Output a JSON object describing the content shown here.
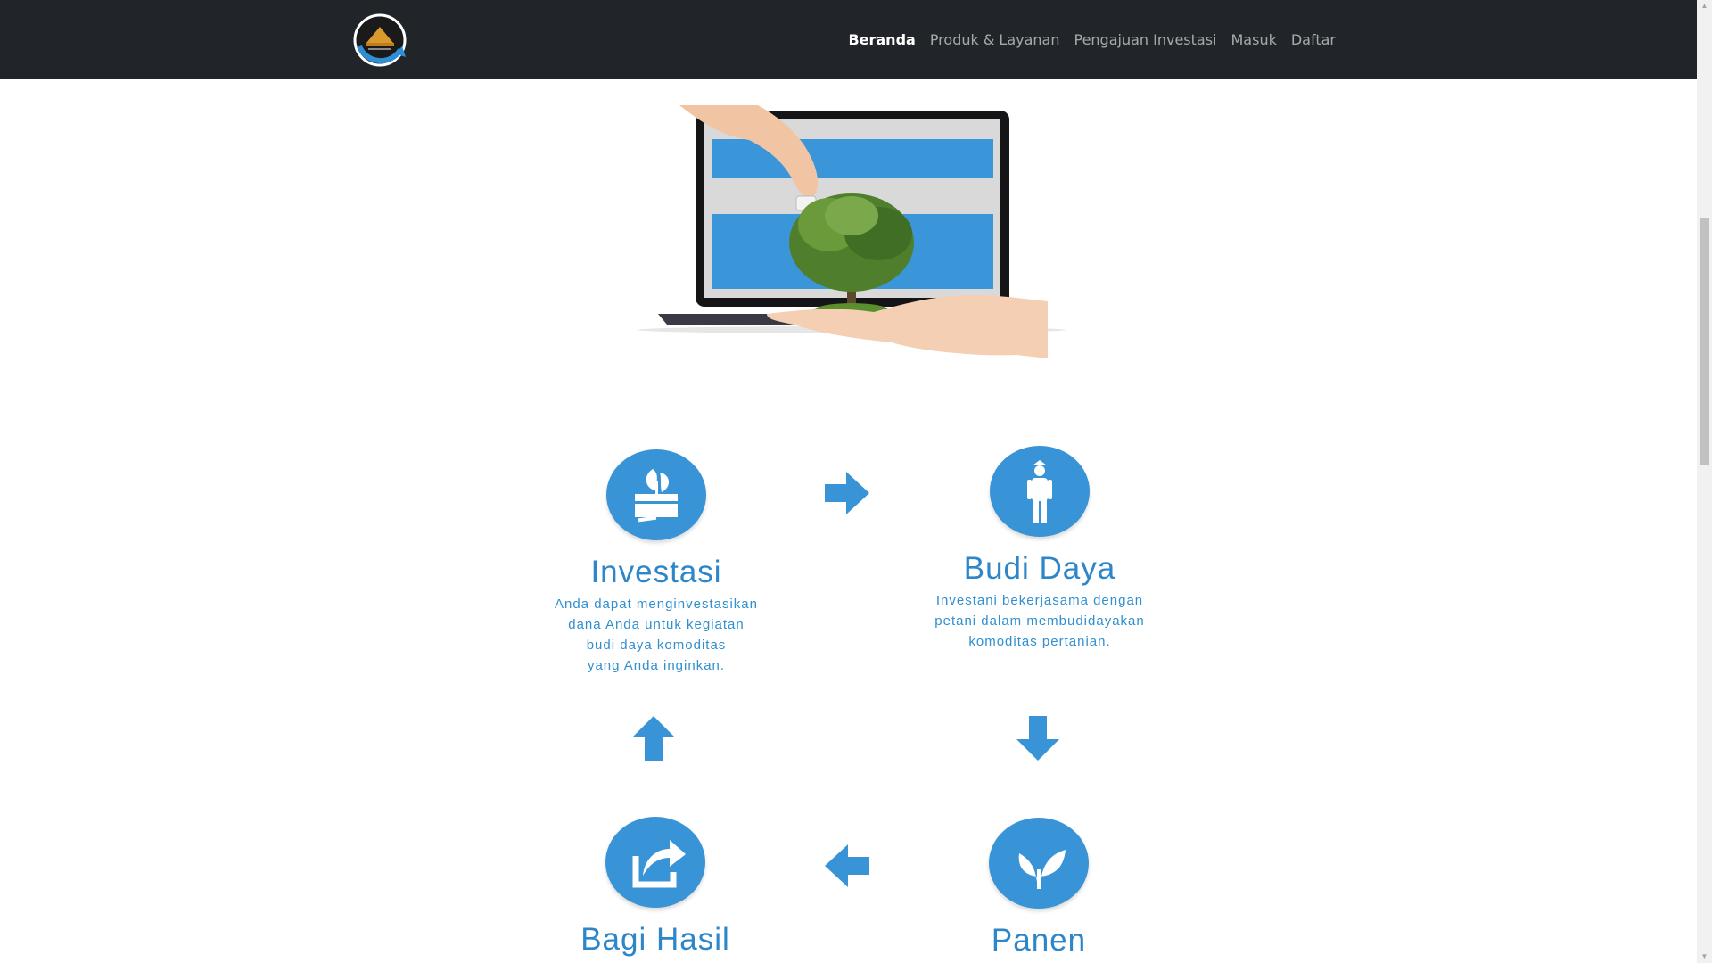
{
  "nav": {
    "logo_icon": "investani-logo",
    "links": [
      "Beranda",
      "Produk & Layanan",
      "Pengajuan Investasi",
      "Masuk",
      "Daftar"
    ],
    "active": "Beranda"
  },
  "hero": {
    "illustration": "laptop-hand-tree"
  },
  "steps": {
    "investasi": {
      "title": "Investasi",
      "desc": [
        "Anda dapat menginvestasikan",
        "dana Anda untuk kegiatan",
        "budi daya komoditas",
        "yang Anda inginkan."
      ],
      "icon": "invest-box-icon"
    },
    "budidaya": {
      "title": "Budi Daya",
      "desc": [
        "Investani bekerjasama dengan",
        "petani dalam membudidayakan",
        "komoditas pertanian."
      ],
      "icon": "farmer-icon"
    },
    "bagihasil": {
      "title": "Bagi Hasil",
      "icon": "share-icon"
    },
    "panen": {
      "title": "Panen",
      "icon": "sprout-icon"
    }
  },
  "colors": {
    "navbar": "#212529",
    "accent": "#3894d6"
  }
}
